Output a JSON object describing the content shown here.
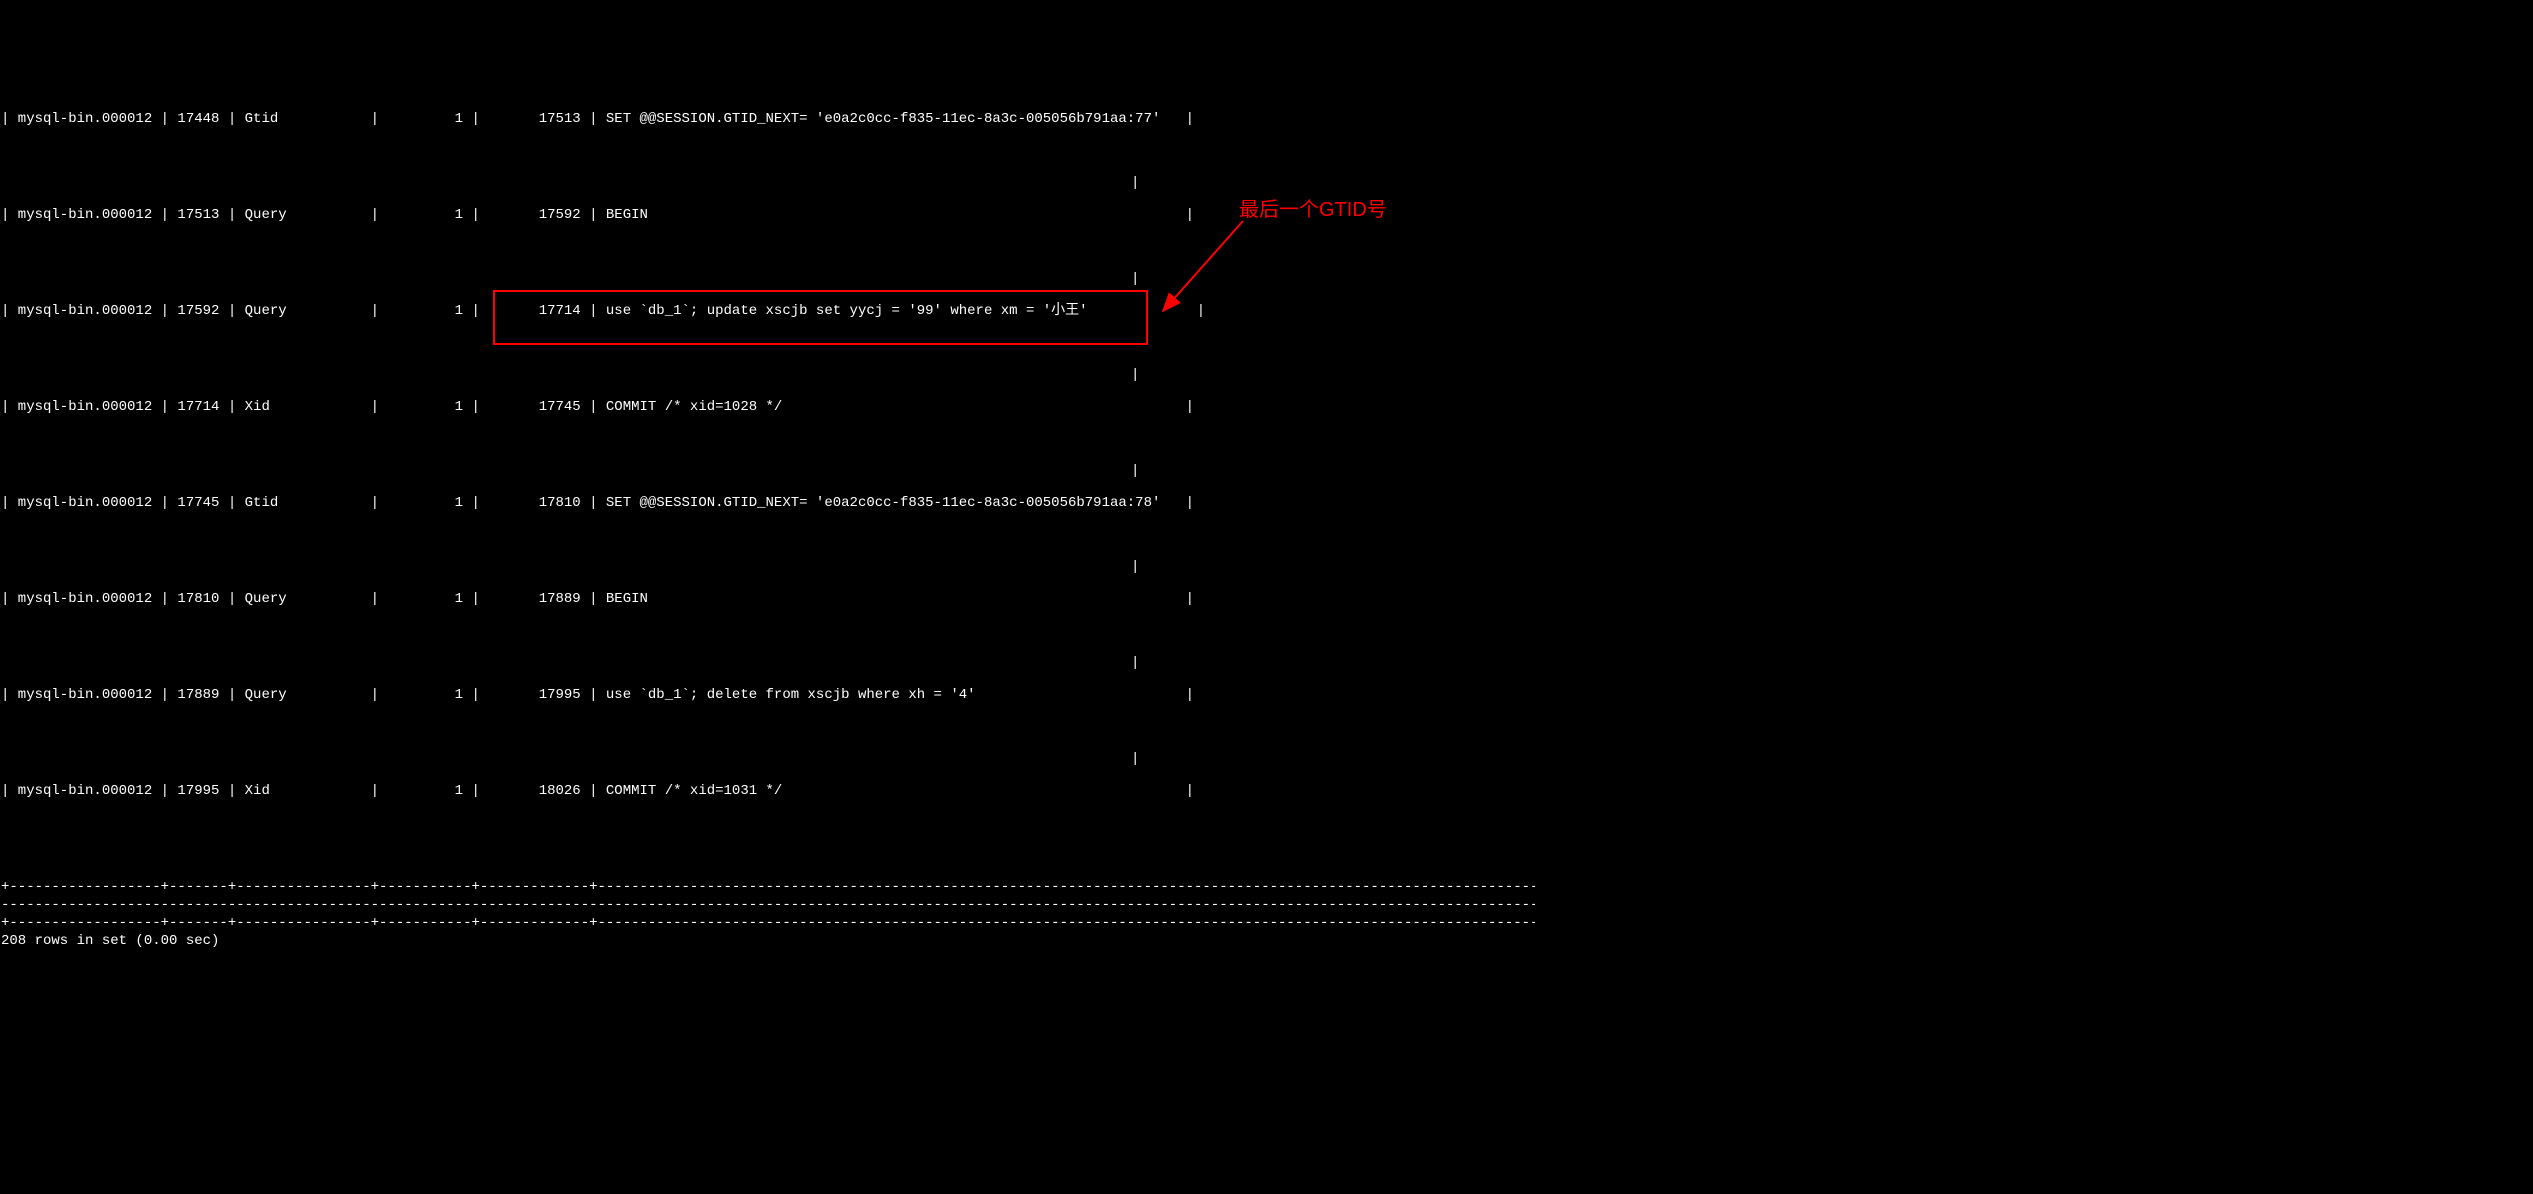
{
  "rows": [
    {
      "log": "mysql-bin.000012",
      "pos": "17448",
      "type": "Gtid",
      "server": "1",
      "endpos": "17513",
      "info": "SET @@SESSION.GTID_NEXT= 'e0a2c0cc-f835-11ec-8a3c-005056b791aa:77'"
    },
    {
      "log": "mysql-bin.000012",
      "pos": "17513",
      "type": "Query",
      "server": "1",
      "endpos": "17592",
      "info": "BEGIN"
    },
    {
      "log": "mysql-bin.000012",
      "pos": "17592",
      "type": "Query",
      "server": "1",
      "endpos": "17714",
      "info": "use `db_1`; update xscjb set yycj = '99' where xm = '小王'"
    },
    {
      "log": "mysql-bin.000012",
      "pos": "17714",
      "type": "Xid",
      "server": "1",
      "endpos": "17745",
      "info": "COMMIT /* xid=1028 */"
    },
    {
      "log": "mysql-bin.000012",
      "pos": "17745",
      "type": "Gtid",
      "server": "1",
      "endpos": "17810",
      "info": "SET @@SESSION.GTID_NEXT= 'e0a2c0cc-f835-11ec-8a3c-005056b791aa:78'"
    },
    {
      "log": "mysql-bin.000012",
      "pos": "17810",
      "type": "Query",
      "server": "1",
      "endpos": "17889",
      "info": "BEGIN"
    },
    {
      "log": "mysql-bin.000012",
      "pos": "17889",
      "type": "Query",
      "server": "1",
      "endpos": "17995",
      "info": "use `db_1`; delete from xscjb where xh = '4'"
    },
    {
      "log": "mysql-bin.000012",
      "pos": "17995",
      "type": "Xid",
      "server": "1",
      "endpos": "18026",
      "info": "COMMIT /* xid=1031 */"
    }
  ],
  "annotation": "最后一个GTID号",
  "footer": "208 rows in set (0.00 sec)",
  "highlight_row_index": 4,
  "sep1": "+------------------+-------+----------------+-----------+-------------+----------------------------------------------------------------------------------------------------------------------------------------------------------------------------------------",
  "sep2": "--------------------------------------------------------------------------------------------------------------------------------------------------------------------------------------------------+",
  "sep3": "+------------------+-------+----------------+-----------+-------------+----------------------------------------------------------------------------------------------------------------------------------------------------------------------------------------"
}
